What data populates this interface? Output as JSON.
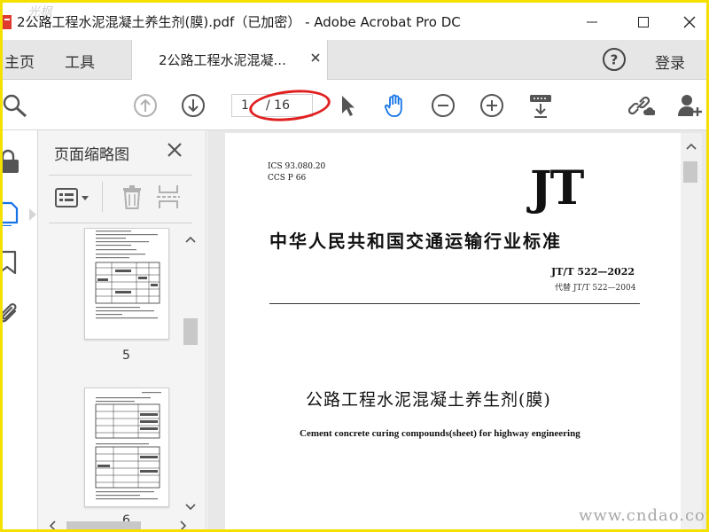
{
  "window": {
    "title": "2公路工程水泥混凝土养生剂(膜).pdf（已加密） - Adobe Acrobat Pro DC",
    "corner_watermark": "光枫"
  },
  "tabs": {
    "home": "主页",
    "tools": "工具",
    "document": "2公路工程水泥混凝...",
    "signin": "登录"
  },
  "toolbar": {
    "current_page": "1",
    "total_pages": "/ 16"
  },
  "thumbnails_panel": {
    "title": "页面缩略图",
    "pages": [
      {
        "number": "5"
      },
      {
        "number": "6"
      }
    ]
  },
  "document": {
    "ics": "ICS 93.080.20",
    "ccs": "CCS P 66",
    "logo": "JT",
    "standard_type": "中华人民共和国交通运输行业标准",
    "code": "JT/T 522—2022",
    "replaces": "代替 JT/T 522—2004",
    "title_cn": "公路工程水泥混凝土养生剂(膜)",
    "title_en": "Cement concrete curing compounds(sheet) for highway engineering"
  },
  "watermark": "www.cndao.com",
  "colors": {
    "accent_blue": "#1473e6",
    "highlight_red": "#e02020",
    "icon_gray": "#555555",
    "disabled_gray": "#b0b0b0",
    "frame_yellow": "#f5e000"
  }
}
